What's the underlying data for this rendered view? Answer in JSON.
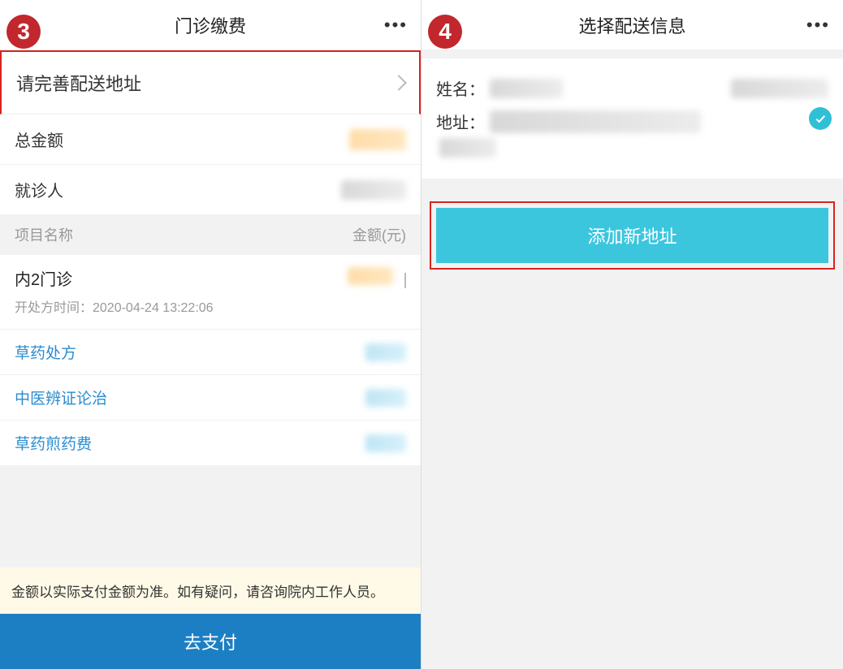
{
  "left": {
    "step_badge": "3",
    "title": "门诊缴费",
    "address_prompt": "请完善配送地址",
    "total_label": "总金额",
    "patient_label": "就诊人",
    "items_header_name": "项目名称",
    "items_header_amount": "金额(元)",
    "dept_name": "内2门诊",
    "dept_time": "开处方时间：2020-04-24 13:22:06",
    "items": [
      "草药处方",
      "中医辨证论治",
      "草药煎药费"
    ],
    "notice": "金额以实际支付金额为准。如有疑问，请咨询院内工作人员。",
    "pay_button": "去支付"
  },
  "right": {
    "step_badge": "4",
    "title": "选择配送信息",
    "name_label": "姓名：",
    "addr_label": "地址：",
    "add_button": "添加新地址"
  }
}
